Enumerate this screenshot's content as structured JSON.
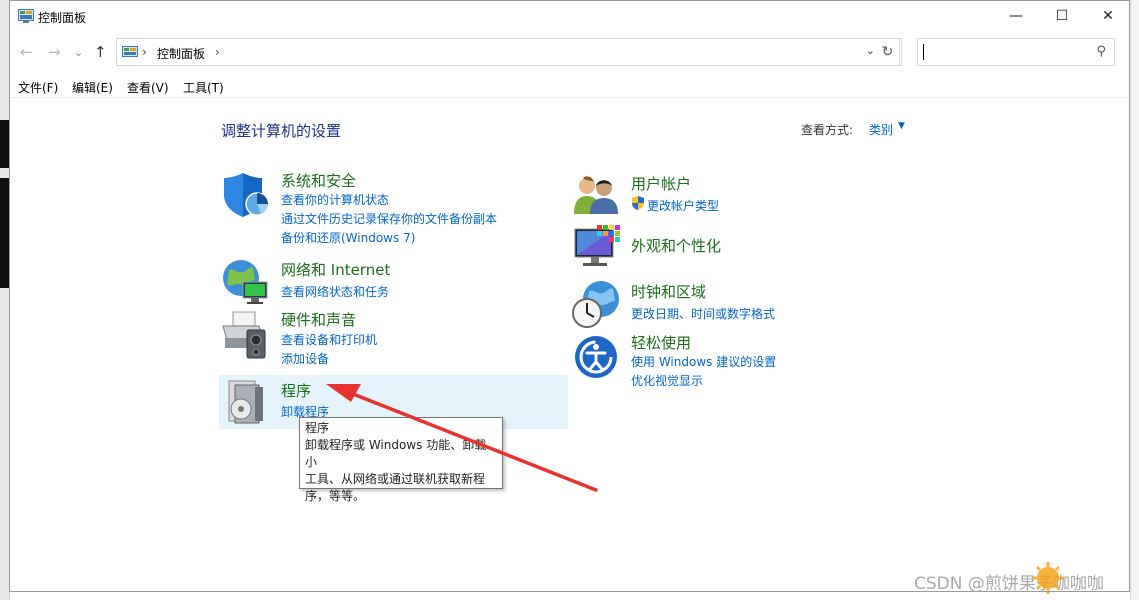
{
  "window": {
    "title": "控制面板",
    "minimize": "—",
    "maximize": "☐",
    "close": "✕"
  },
  "address": {
    "path": "控制面板",
    "search_placeholder": ""
  },
  "menu": [
    "文件(F)",
    "编辑(E)",
    "查看(V)",
    "工具(T)"
  ],
  "content": {
    "heading": "调整计算机的设置",
    "view_by_label": "查看方式:",
    "view_by_value": "类别"
  },
  "categories": {
    "system": {
      "title": "系统和安全",
      "links": [
        "查看你的计算机状态",
        "通过文件历史记录保存你的文件备份副本",
        "备份和还原(Windows 7)"
      ]
    },
    "network": {
      "title": "网络和 Internet",
      "links": [
        "查看网络状态和任务"
      ]
    },
    "hardware": {
      "title": "硬件和声音",
      "links": [
        "查看设备和打印机",
        "添加设备"
      ]
    },
    "programs": {
      "title": "程序",
      "links": [
        "卸载程序"
      ]
    },
    "user": {
      "title": "用户帐户",
      "links": [
        "更改帐户类型"
      ]
    },
    "appearance": {
      "title": "外观和个性化"
    },
    "clock": {
      "title": "时钟和区域",
      "links": [
        "更改日期、时间或数字格式"
      ]
    },
    "ease": {
      "title": "轻松使用",
      "links": [
        "使用 Windows 建议的设置",
        "优化视觉显示"
      ]
    }
  },
  "tooltip": {
    "title": "程序",
    "line1": "卸载程序或 Windows 功能、卸载小",
    "line2": "工具、从网络或通过联机获取新程",
    "line3": "序，等等。"
  },
  "watermark": "CSDN @煎饼果子咖咖咖",
  "colors": {
    "category_title": "#1a6e1a",
    "link": "#0066cc",
    "heading": "#1e3287",
    "annotation_arrow": "#e8322f",
    "hover": "#e5f3fb"
  }
}
